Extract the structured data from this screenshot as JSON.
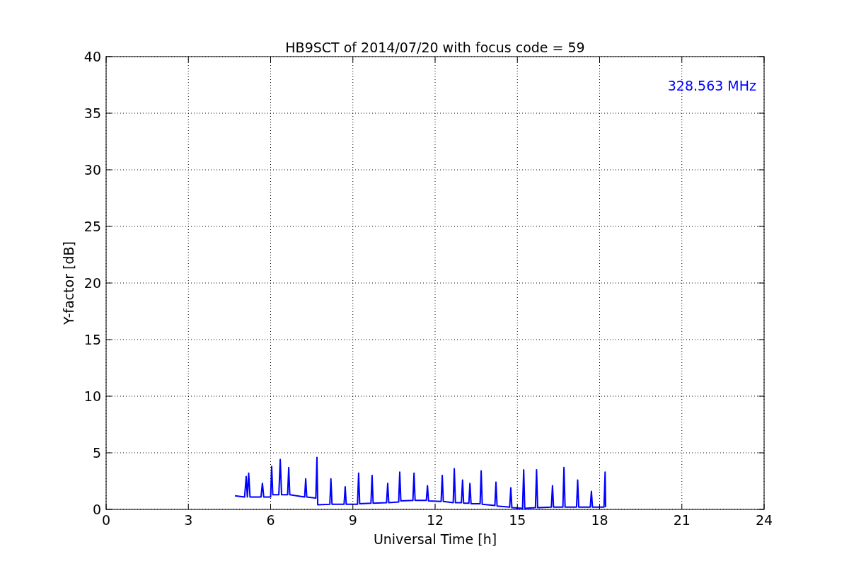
{
  "figure": {
    "chart_data": {
      "type": "line",
      "title": "HB9SCT of 2014/07/20 with focus code = 59",
      "xlabel": "Universal Time [h]",
      "ylabel": "Y-factor [dB]",
      "xlim": [
        0,
        24
      ],
      "ylim": [
        0,
        40
      ],
      "xticks": [
        0,
        3,
        6,
        9,
        12,
        15,
        18,
        21,
        24
      ],
      "yticks": [
        0,
        5,
        10,
        15,
        20,
        25,
        30,
        35,
        40
      ],
      "x": [
        4.7,
        5.05,
        5.11,
        5.15,
        5.2,
        5.25,
        5.65,
        5.7,
        5.75,
        6.0,
        6.04,
        6.08,
        6.3,
        6.35,
        6.4,
        6.62,
        6.66,
        6.7,
        7.24,
        7.28,
        7.32,
        7.65,
        7.69,
        7.72,
        8.16,
        8.2,
        8.24,
        8.68,
        8.72,
        8.76,
        9.17,
        9.21,
        9.25,
        9.66,
        9.7,
        9.74,
        10.23,
        10.27,
        10.31,
        10.67,
        10.71,
        10.75,
        11.19,
        11.23,
        11.27,
        11.68,
        11.72,
        11.76,
        12.22,
        12.26,
        12.3,
        12.66,
        12.7,
        12.74,
        12.96,
        13.0,
        13.04,
        13.23,
        13.27,
        13.31,
        13.64,
        13.68,
        13.72,
        14.18,
        14.22,
        14.26,
        14.72,
        14.76,
        14.8,
        15.19,
        15.23,
        15.27,
        15.66,
        15.7,
        15.74,
        16.24,
        16.28,
        16.32,
        16.66,
        16.7,
        16.74,
        17.16,
        17.2,
        17.24,
        17.66,
        17.7,
        17.74,
        18.16,
        18.2,
        18.22
      ],
      "grid": true,
      "series": [
        {
          "color": "#0000ff",
          "values": [
            1.2,
            1.1,
            2.9,
            1.1,
            3.2,
            1.1,
            1.1,
            2.3,
            1.1,
            1.1,
            3.8,
            1.3,
            1.3,
            4.4,
            1.3,
            1.3,
            3.7,
            1.3,
            1.1,
            2.7,
            1.1,
            1.0,
            4.6,
            0.4,
            0.45,
            2.7,
            0.45,
            0.45,
            2.0,
            0.45,
            0.45,
            3.2,
            0.5,
            0.55,
            3.0,
            0.55,
            0.6,
            2.3,
            0.6,
            0.65,
            3.3,
            0.75,
            0.8,
            3.2,
            0.8,
            0.8,
            2.1,
            0.75,
            0.7,
            3.0,
            0.7,
            0.6,
            3.6,
            0.6,
            0.6,
            2.6,
            0.55,
            0.55,
            2.3,
            0.5,
            0.5,
            3.4,
            0.45,
            0.35,
            2.4,
            0.3,
            0.2,
            1.9,
            0.15,
            0.1,
            3.5,
            0.1,
            0.15,
            3.5,
            0.15,
            0.2,
            2.1,
            0.2,
            0.2,
            3.7,
            0.2,
            0.2,
            2.6,
            0.2,
            0.2,
            1.6,
            0.2,
            0.2,
            3.3,
            0.2
          ]
        }
      ],
      "annotations": [
        {
          "text": "328.563 MHz"
        }
      ]
    }
  }
}
